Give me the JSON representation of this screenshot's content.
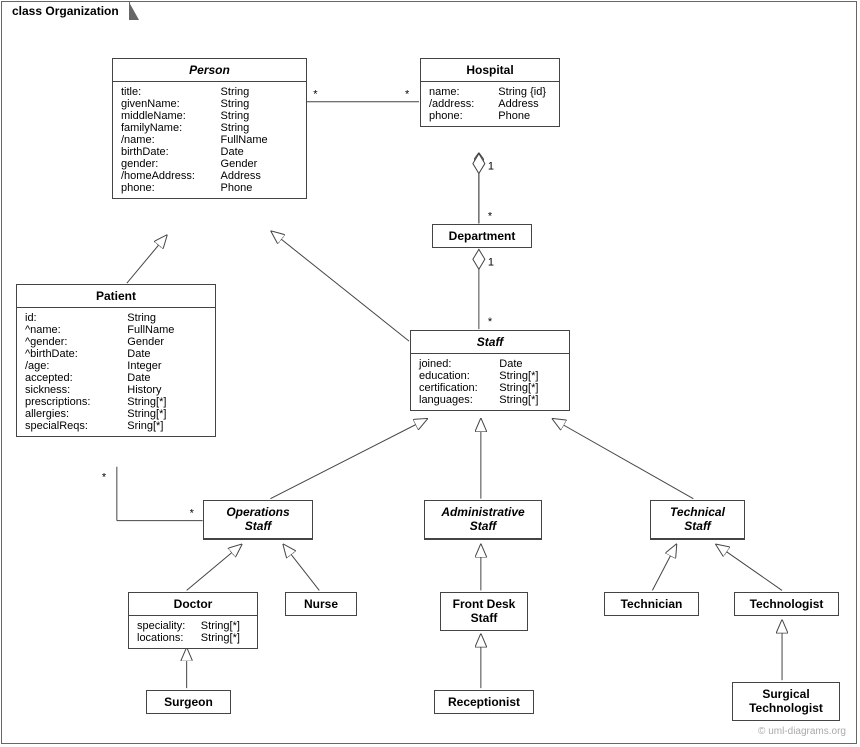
{
  "frame_label": "class Organization",
  "watermark": "© uml-diagrams.org",
  "classes": {
    "person": {
      "name": "Person",
      "attrs": [
        [
          "title:",
          "String"
        ],
        [
          "givenName:",
          "String"
        ],
        [
          "middleName:",
          "String"
        ],
        [
          "familyName:",
          "String"
        ],
        [
          "/name:",
          "FullName"
        ],
        [
          "birthDate:",
          "Date"
        ],
        [
          "gender:",
          "Gender"
        ],
        [
          "/homeAddress:",
          "Address"
        ],
        [
          "phone:",
          "Phone"
        ]
      ]
    },
    "hospital": {
      "name": "Hospital",
      "attrs": [
        [
          "name:",
          "String {id}"
        ],
        [
          "/address:",
          "Address"
        ],
        [
          "phone:",
          "Phone"
        ]
      ]
    },
    "department": {
      "name": "Department",
      "attrs": []
    },
    "patient": {
      "name": "Patient",
      "attrs": [
        [
          "id:",
          "String"
        ],
        [
          "^name:",
          "FullName"
        ],
        [
          "^gender:",
          "Gender"
        ],
        [
          "^birthDate:",
          "Date"
        ],
        [
          "/age:",
          "Integer"
        ],
        [
          "accepted:",
          "Date"
        ],
        [
          "sickness:",
          "History"
        ],
        [
          "prescriptions:",
          "String[*]"
        ],
        [
          "allergies:",
          "String[*]"
        ],
        [
          "specialReqs:",
          "Sring[*]"
        ]
      ]
    },
    "staff": {
      "name": "Staff",
      "attrs": [
        [
          "joined:",
          "Date"
        ],
        [
          "education:",
          "String[*]"
        ],
        [
          "certification:",
          "String[*]"
        ],
        [
          "languages:",
          "String[*]"
        ]
      ]
    },
    "operations_staff": {
      "name": "Operations\nStaff",
      "attrs": []
    },
    "administrative_staff": {
      "name": "Administrative\nStaff",
      "attrs": []
    },
    "technical_staff": {
      "name": "Technical\nStaff",
      "attrs": []
    },
    "doctor": {
      "name": "Doctor",
      "attrs": [
        [
          "speciality:",
          "String[*]"
        ],
        [
          "locations:",
          "String[*]"
        ]
      ]
    },
    "nurse": {
      "name": "Nurse",
      "attrs": []
    },
    "frontdesk": {
      "name": "Front Desk\nStaff",
      "attrs": []
    },
    "technician": {
      "name": "Technician",
      "attrs": []
    },
    "technologist": {
      "name": "Technologist",
      "attrs": []
    },
    "surgeon": {
      "name": "Surgeon",
      "attrs": []
    },
    "receptionist": {
      "name": "Receptionist",
      "attrs": []
    },
    "surgtech": {
      "name": "Surgical\nTechnologist",
      "attrs": []
    }
  },
  "labels": {
    "star": "*",
    "one": "1"
  }
}
